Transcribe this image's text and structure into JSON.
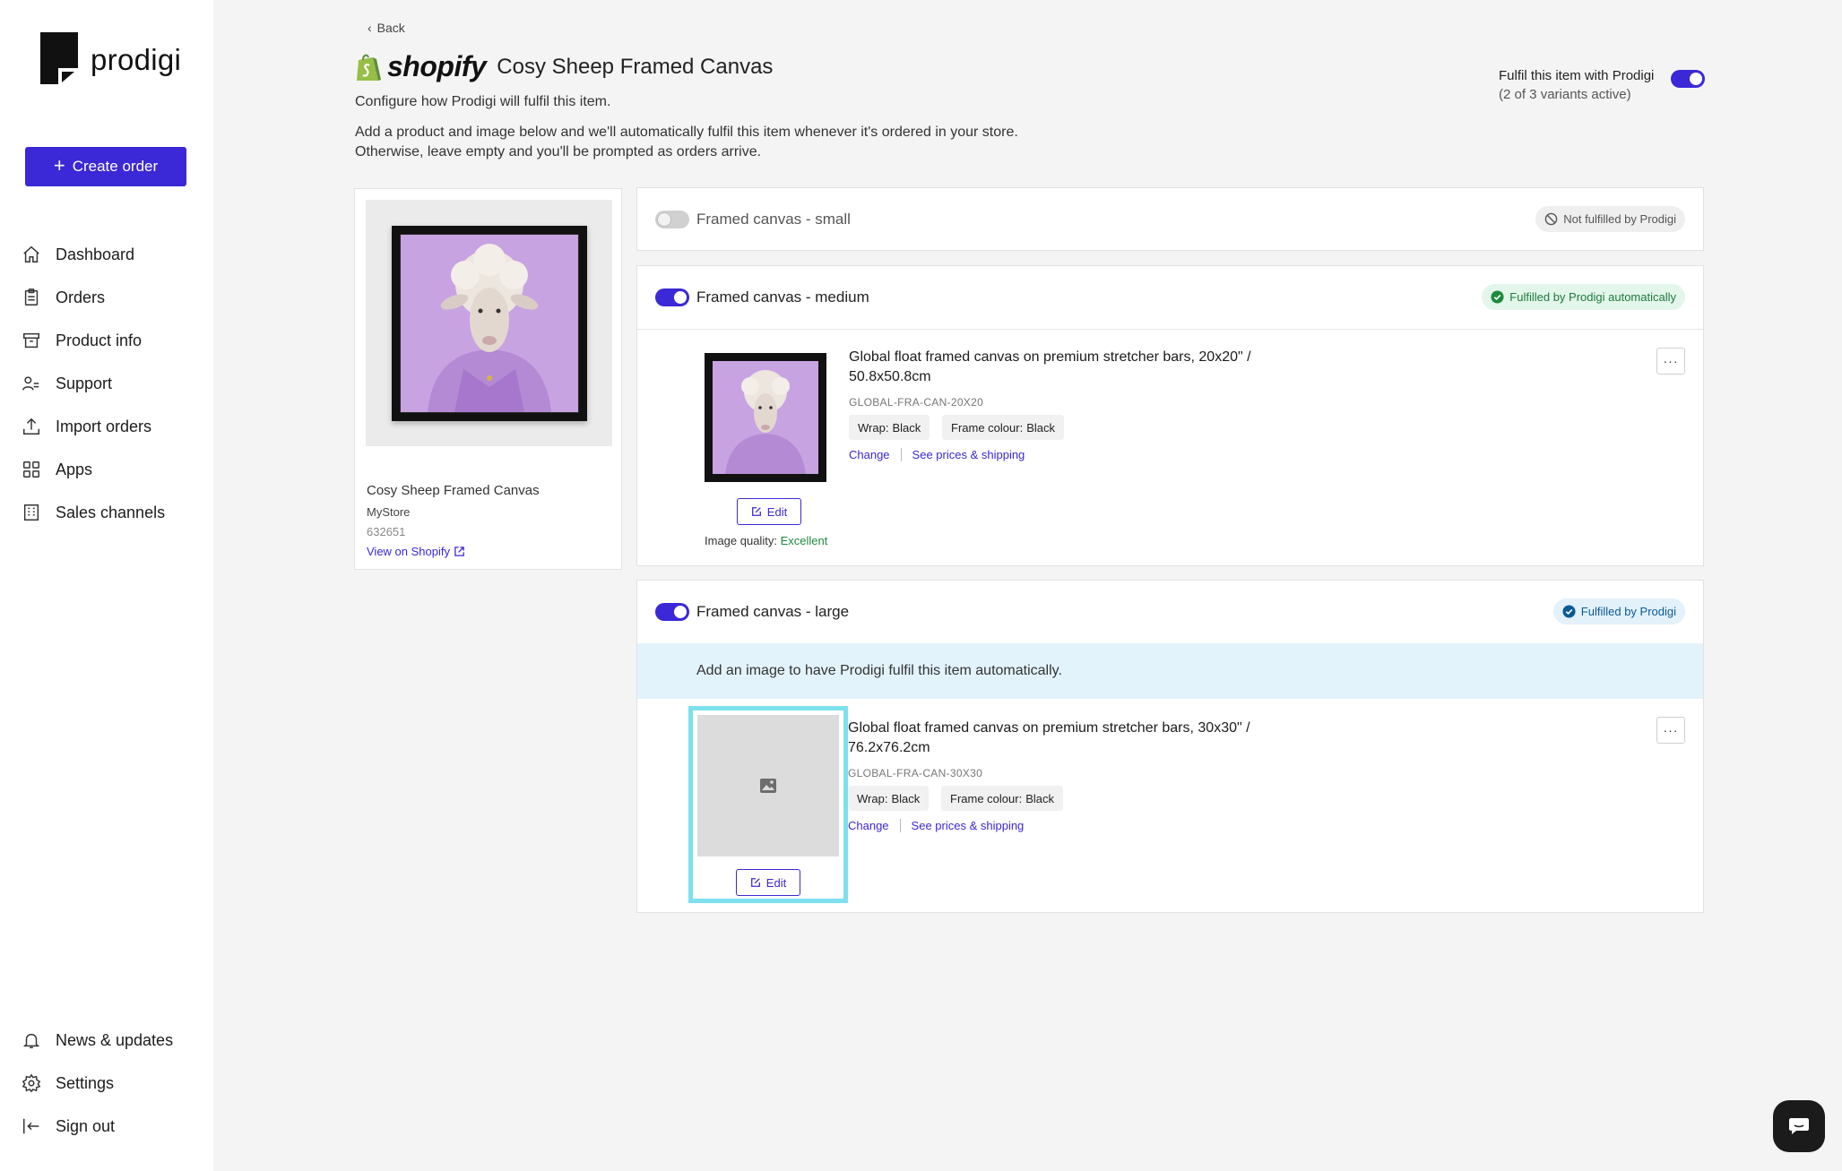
{
  "brand": {
    "name": "prodigi",
    "accent": "#3b28d6"
  },
  "sidebar": {
    "create_label": "Create order",
    "items": [
      {
        "label": "Dashboard",
        "icon": "home-icon"
      },
      {
        "label": "Orders",
        "icon": "clipboard-icon"
      },
      {
        "label": "Product info",
        "icon": "archive-icon"
      },
      {
        "label": "Support",
        "icon": "users-icon"
      },
      {
        "label": "Import orders",
        "icon": "upload-icon"
      },
      {
        "label": "Apps",
        "icon": "grid-icon"
      },
      {
        "label": "Sales channels",
        "icon": "building-icon"
      }
    ],
    "bottom": [
      {
        "label": "News & updates",
        "icon": "bell-icon"
      },
      {
        "label": "Settings",
        "icon": "gear-icon"
      },
      {
        "label": "Sign out",
        "icon": "sign-out-icon"
      }
    ]
  },
  "header": {
    "back_label": "Back",
    "platform": "shopify",
    "title": "Cosy Sheep Framed Canvas",
    "subtitle": "Configure how Prodigi will fulfil this item.",
    "desc_line1": "Add a product and image below and we'll automatically fulfil this item whenever it's ordered in your store.",
    "desc_line2": "Otherwise, leave empty and you'll be prompted as orders arrive.",
    "fulfil_label": "Fulfil this item with Prodigi",
    "fulfil_sub": "(2 of 3 variants active)",
    "fulfil_enabled": true
  },
  "product": {
    "name": "Cosy Sheep Framed Canvas",
    "store": "MyStore",
    "id": "632651",
    "link_label": "View on Shopify"
  },
  "variants": [
    {
      "label": "Framed canvas - small",
      "enabled": false,
      "badge": "Not fulfilled by Prodigi"
    },
    {
      "label": "Framed canvas - medium",
      "enabled": true,
      "badge": "Fulfilled by Prodigi automatically",
      "item": {
        "title": "Global float framed canvas on premium stretcher bars, 20x20\" / 50.8x50.8cm",
        "sku": "GLOBAL-FRA-CAN-20X20",
        "wrap_label": "Wrap:",
        "wrap_value": "Black",
        "frame_label": "Frame colour:",
        "frame_value": "Black",
        "change_label": "Change",
        "prices_label": "See prices & shipping",
        "edit_label": "Edit",
        "quality_label": "Image quality:",
        "quality_value": "Excellent"
      }
    },
    {
      "label": "Framed canvas - large",
      "enabled": true,
      "badge": "Fulfilled by Prodigi",
      "notice": "Add an image to have Prodigi fulfil this item automatically.",
      "item": {
        "title": "Global float framed canvas on premium stretcher bars, 30x30\" / 76.2x76.2cm",
        "sku": "GLOBAL-FRA-CAN-30X30",
        "wrap_label": "Wrap:",
        "wrap_value": "Black",
        "frame_label": "Frame colour:",
        "frame_value": "Black",
        "change_label": "Change",
        "prices_label": "See prices & shipping",
        "edit_label": "Edit"
      }
    }
  ]
}
